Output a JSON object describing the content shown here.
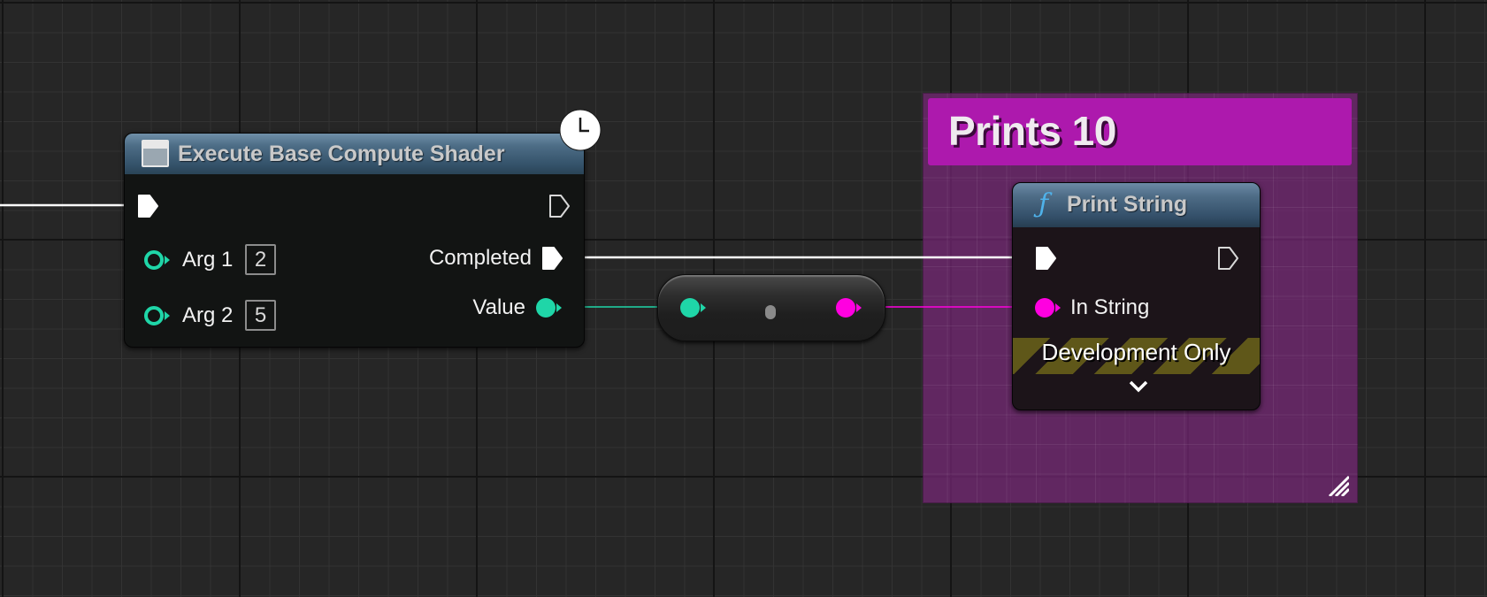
{
  "colors": {
    "exec_wire": "#ffffff",
    "int_pin": "#1fd6a8",
    "string_pin": "#ff00e0",
    "comment_header": "#ad19ad",
    "comment_body": "#652965",
    "node_title": "#4d6d86",
    "dev_stripe": "#5f5719"
  },
  "comment": {
    "title": "Prints 10",
    "resize_icon": "resize-grip-icon"
  },
  "exec_node": {
    "title": "Execute Base Compute Shader",
    "title_icon": "window-icon",
    "latent_icon": "clock-icon",
    "inputs": [
      {
        "label": "Arg 1",
        "value": "2",
        "type": "integer"
      },
      {
        "label": "Arg 2",
        "value": "5",
        "type": "integer"
      }
    ],
    "outputs": [
      {
        "label": "Completed",
        "type": "exec"
      },
      {
        "label": "Value",
        "type": "integer"
      }
    ]
  },
  "convert_node": {
    "from": "integer",
    "to": "string"
  },
  "print_node": {
    "title": "Print String",
    "title_icon": "function-icon",
    "inputs": [
      {
        "label": "In String",
        "type": "string"
      }
    ],
    "dev_only_label": "Development Only",
    "expand_icon": "chevron-down-icon"
  }
}
